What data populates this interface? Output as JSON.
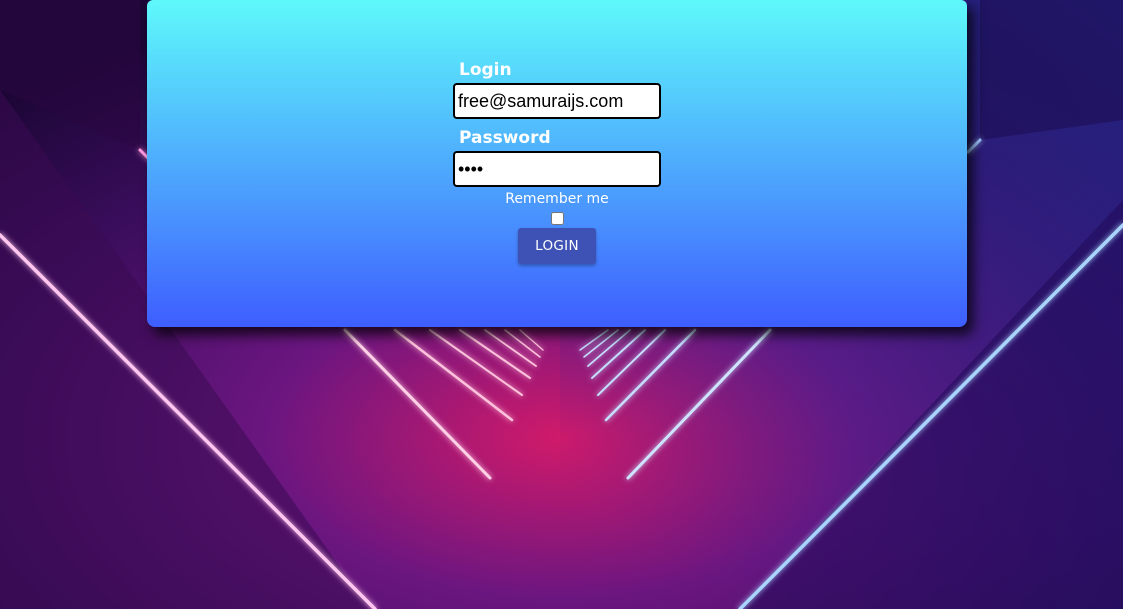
{
  "colors": {
    "card_gradient_top": "#5ef9fb",
    "card_gradient_bottom": "#3e5eff",
    "button_bg": "#3e51b5",
    "label_text": "#ffffff",
    "neon_pink": "#ff3c8a",
    "neon_blue": "#4a8bff"
  },
  "login_form": {
    "login_label": "Login",
    "login_value": "free@samuraijs.com",
    "password_label": "Password",
    "password_value": "free",
    "remember_label": "Remember me",
    "remember_checked": false,
    "submit_label": "LOGIN"
  }
}
